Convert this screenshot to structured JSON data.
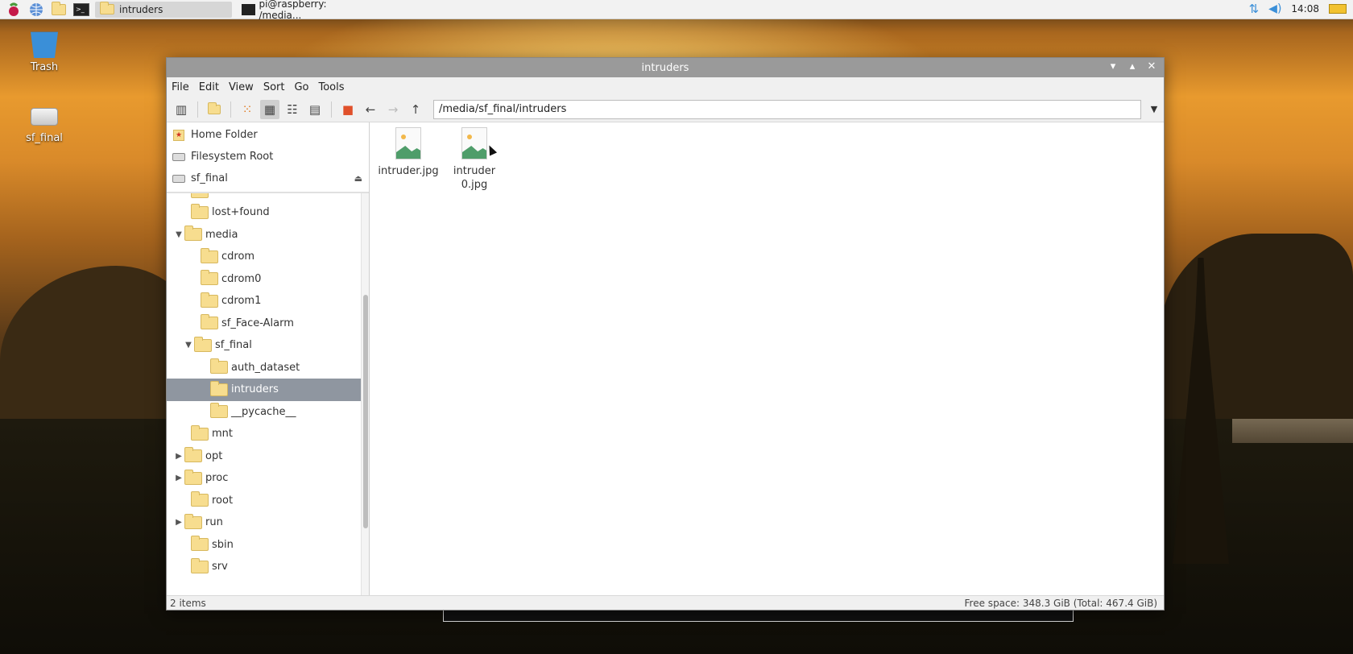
{
  "taskbar": {
    "tasks": [
      {
        "label": "intruders"
      },
      {
        "label": "pi@raspberry: /media..."
      }
    ],
    "clock": "14:08"
  },
  "desktop": {
    "icons": [
      {
        "label": "Trash"
      },
      {
        "label": "sf_final"
      }
    ]
  },
  "window": {
    "title": "intruders",
    "menu": [
      "File",
      "Edit",
      "View",
      "Sort",
      "Go",
      "Tools"
    ],
    "path": "/media/sf_final/intruders",
    "places": [
      {
        "label": "Home Folder"
      },
      {
        "label": "Filesystem Root"
      },
      {
        "label": "sf_final"
      }
    ],
    "tree": [
      {
        "label": "lost+found"
      },
      {
        "label": "media"
      },
      {
        "label": "cdrom"
      },
      {
        "label": "cdrom0"
      },
      {
        "label": "cdrom1"
      },
      {
        "label": "sf_Face-Alarm"
      },
      {
        "label": "sf_final"
      },
      {
        "label": "auth_dataset"
      },
      {
        "label": "intruders"
      },
      {
        "label": "__pycache__"
      },
      {
        "label": "mnt"
      },
      {
        "label": "opt"
      },
      {
        "label": "proc"
      },
      {
        "label": "root"
      },
      {
        "label": "run"
      },
      {
        "label": "sbin"
      },
      {
        "label": "srv"
      }
    ],
    "files": [
      {
        "name": "intruder.jpg"
      },
      {
        "name": "intruder0.jpg"
      }
    ],
    "status": {
      "items": "2 items",
      "free_space": "Free space: 348.3 GiB (Total: 467.4 GiB)"
    }
  },
  "colors": {
    "selection": "#8f96a0",
    "folder": "#f7dd8f",
    "titlebar": "#9a9a9a"
  }
}
